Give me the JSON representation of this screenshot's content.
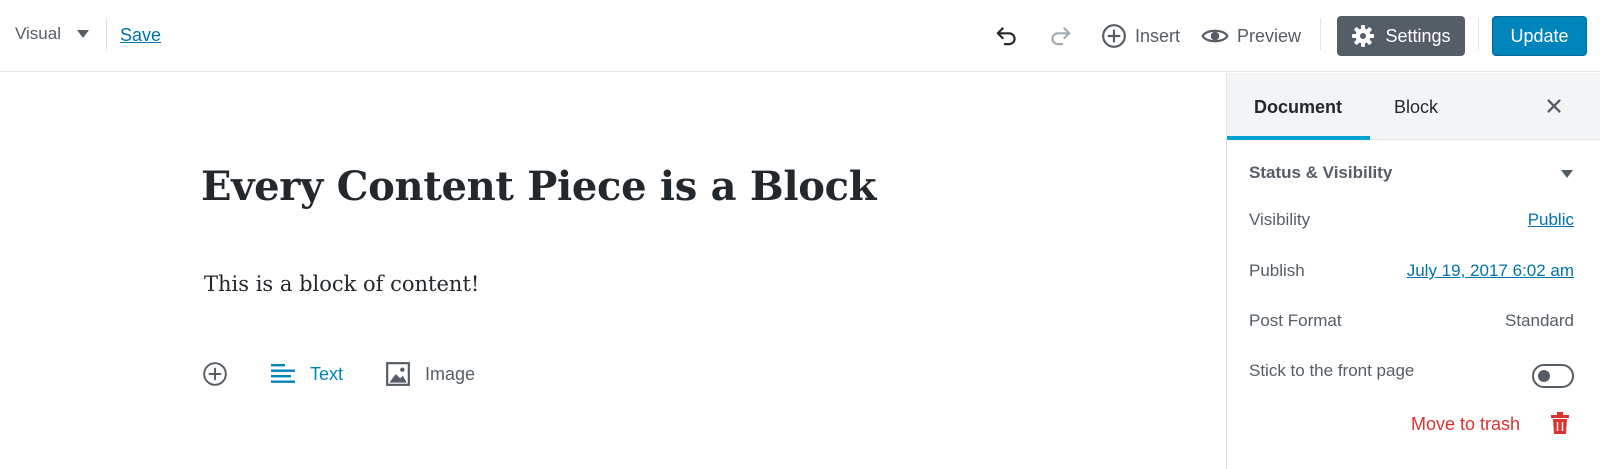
{
  "toolbar": {
    "mode_label": "Visual",
    "save_label": "Save",
    "insert_label": "Insert",
    "preview_label": "Preview",
    "settings_label": "Settings",
    "update_label": "Update",
    "icons": [
      "undo-icon",
      "redo-icon",
      "plus-circle-icon",
      "eye-icon",
      "gear-icon"
    ]
  },
  "editor": {
    "title": "Every Content Piece is a Block",
    "paragraph": "This is a block of content!",
    "inserter": {
      "text_label": "Text",
      "image_label": "Image"
    }
  },
  "sidebar": {
    "tabs": [
      {
        "label": "Document",
        "active": true
      },
      {
        "label": "Block",
        "active": false
      }
    ],
    "panel": {
      "title": "Status & Visibility",
      "rows": [
        {
          "label": "Visibility",
          "value": "Public"
        },
        {
          "label": "Publish",
          "value": "July 19, 2017 6:02 am"
        },
        {
          "label": "Post Format",
          "value": "Standard"
        },
        {
          "label": "Stick to the front page",
          "value": "off"
        }
      ],
      "trash_label": "Move to trash"
    }
  },
  "colors": {
    "accent": "#0085ba",
    "link": "#0073aa",
    "danger": "#dc3232",
    "dark_button": "#555d66",
    "tab_underline": "#00a0d2"
  }
}
